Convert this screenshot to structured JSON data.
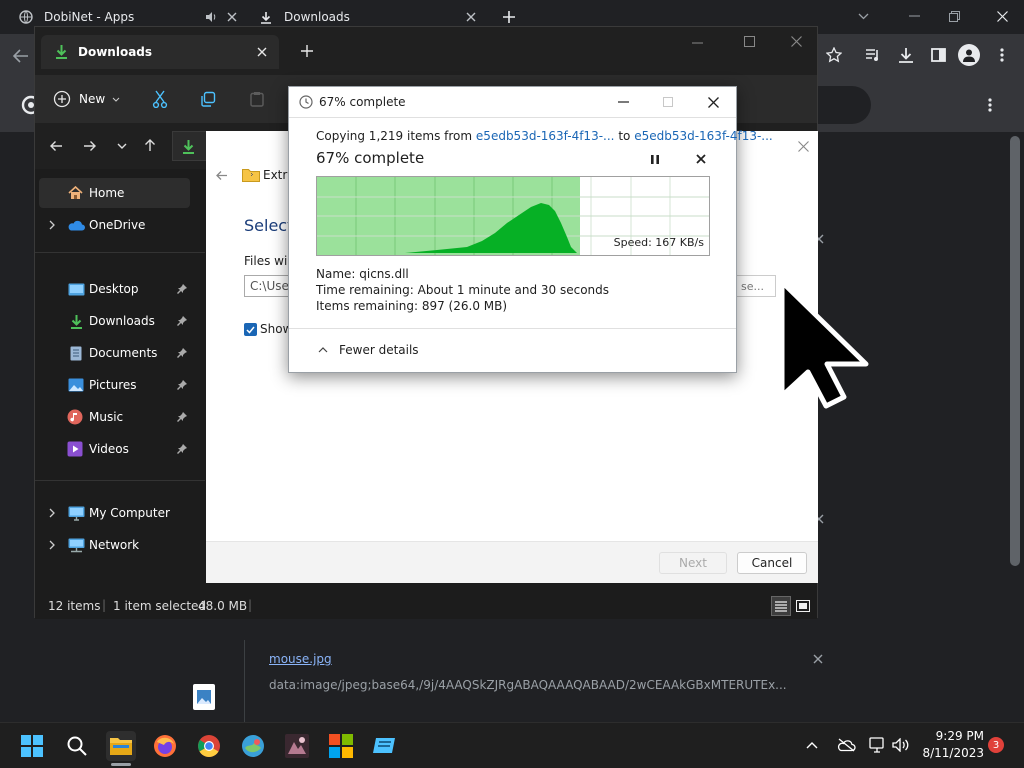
{
  "chrome": {
    "tabs": [
      {
        "title": "DobiNet - Apps"
      },
      {
        "title": "Downloads"
      }
    ]
  },
  "explorer": {
    "tab_title": "Downloads",
    "new_label": "New",
    "sidebar": {
      "home": "Home",
      "onedrive": "OneDrive",
      "desktop": "Desktop",
      "downloads": "Downloads",
      "documents": "Documents",
      "pictures": "Pictures",
      "music": "Music",
      "videos": "Videos",
      "my_computer": "My Computer",
      "network": "Network"
    },
    "status": {
      "items": "12 items",
      "selected": "1 item selected",
      "size": "48.0 MB"
    }
  },
  "wizard": {
    "breadcrumb": "Extra",
    "heading": "Select",
    "files_label": "Files will",
    "path_value": "C:\\User",
    "browse_partial": "se...",
    "show_label": "Show",
    "next_label": "Next",
    "cancel_label": "Cancel"
  },
  "copy_dialog": {
    "title": "67% complete",
    "copying_prefix": "Copying 1,219 items from",
    "source": "e5edb53d-163f-4f13-...",
    "to_word": "to",
    "destination": "e5edb53d-163f-4f13-...",
    "heading": "67% complete",
    "progress_fraction": 0.67,
    "speed": "Speed: 167 KB/s",
    "name_line": "Name:  qicns.dll",
    "time_line": "Time remaining:  About 1 minute and 30 seconds",
    "items_line": "Items remaining:  897 (26.0 MB)",
    "fewer_details": "Fewer details"
  },
  "downloads_page": {
    "file_name": "mouse.jpg",
    "file_url": "data:image/jpeg;base64,/9j/4AAQSkZJRgABAQAAAQABAAD/2wCEAAkGBxMTERUTEx..."
  },
  "taskbar": {
    "time": "9:29 PM",
    "date": "8/11/2023",
    "notification_count": "3"
  },
  "colors": {
    "accent": "#4cc2ff",
    "progress_green": "#06b025",
    "progress_fill": "#9be19b",
    "link_blue": "#1a66b5"
  }
}
